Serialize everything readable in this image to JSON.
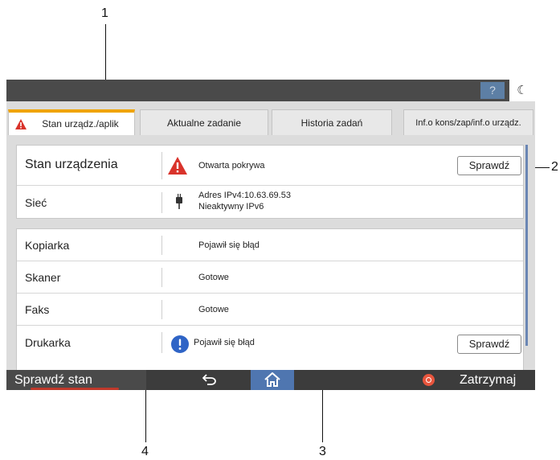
{
  "callouts": {
    "c1": "1",
    "c2": "2",
    "c3": "3",
    "c4": "4"
  },
  "topbar": {
    "help_label": "?",
    "moon_label": "☾"
  },
  "tabs": [
    {
      "label": "Stan urządz./aplik"
    },
    {
      "label": "Aktualne zadanie"
    },
    {
      "label": "Historia zadań"
    },
    {
      "label": "Inf.o kons/zap/inf.o urządz."
    }
  ],
  "device_panel": {
    "status_row": {
      "label": "Stan urządzenia",
      "status": "Otwarta pokrywa",
      "button": "Sprawdź"
    },
    "network_row": {
      "label": "Sieć",
      "line1": "Adres IPv4:10.63.69.53",
      "line2": "Nieaktywny IPv6"
    }
  },
  "functions": [
    {
      "label": "Kopiarka",
      "status": "Pojawił się błąd"
    },
    {
      "label": "Skaner",
      "status": "Gotowe"
    },
    {
      "label": "Faks",
      "status": "Gotowe"
    },
    {
      "label": "Drukarka",
      "status": "Pojawił się błąd",
      "button": "Sprawdź"
    }
  ],
  "bottombar": {
    "check_status": "Sprawdź stan",
    "stop": "Zatrzymaj"
  },
  "icons": {
    "warning": "warning-triangle-icon",
    "info": "info-circle-icon",
    "network": "network-plug-icon",
    "back": "back-arrow-icon",
    "home": "home-icon",
    "stop": "stop-icon",
    "help": "help-icon",
    "moon": "moon-icon"
  },
  "colors": {
    "accent_tab": "#f0a400",
    "warning": "#d9332b",
    "info": "#2f64c6",
    "home": "#4f76b0",
    "stop": "#e8553d"
  }
}
